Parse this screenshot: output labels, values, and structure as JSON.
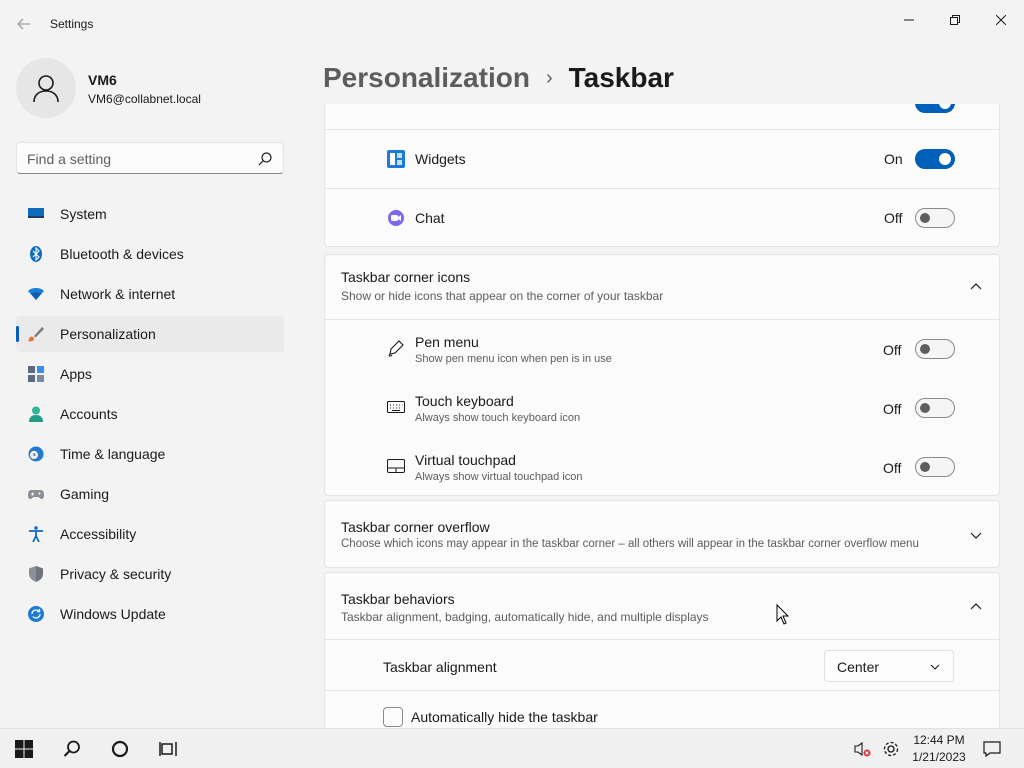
{
  "window": {
    "title": "Settings"
  },
  "profile": {
    "name": "VM6",
    "email": "VM6@collabnet.local"
  },
  "search": {
    "placeholder": "Find a setting"
  },
  "nav": [
    {
      "label": "System",
      "icon": "monitor-icon"
    },
    {
      "label": "Bluetooth & devices",
      "icon": "bluetooth-icon"
    },
    {
      "label": "Network & internet",
      "icon": "wifi-icon"
    },
    {
      "label": "Personalization",
      "icon": "brush-icon",
      "active": true
    },
    {
      "label": "Apps",
      "icon": "apps-icon"
    },
    {
      "label": "Accounts",
      "icon": "person-icon"
    },
    {
      "label": "Time & language",
      "icon": "globe-clock-icon"
    },
    {
      "label": "Gaming",
      "icon": "gamepad-icon"
    },
    {
      "label": "Accessibility",
      "icon": "accessibility-icon"
    },
    {
      "label": "Privacy & security",
      "icon": "shield-icon"
    },
    {
      "label": "Windows Update",
      "icon": "update-icon"
    }
  ],
  "header": {
    "parent": "Personalization",
    "separator": "›",
    "current": "Taskbar"
  },
  "taskbar_items": {
    "widgets": {
      "label": "Widgets",
      "state": "On",
      "on": true
    },
    "chat": {
      "label": "Chat",
      "state": "Off",
      "on": false
    }
  },
  "corner_icons": {
    "title": "Taskbar corner icons",
    "subtitle": "Show or hide icons that appear on the corner of your taskbar",
    "items": [
      {
        "title": "Pen menu",
        "subtitle": "Show pen menu icon when pen is in use",
        "state": "Off"
      },
      {
        "title": "Touch keyboard",
        "subtitle": "Always show touch keyboard icon",
        "state": "Off"
      },
      {
        "title": "Virtual touchpad",
        "subtitle": "Always show virtual touchpad icon",
        "state": "Off"
      }
    ]
  },
  "corner_overflow": {
    "title": "Taskbar corner overflow",
    "subtitle": "Choose which icons may appear in the taskbar corner – all others will appear in the taskbar corner overflow menu"
  },
  "behaviors": {
    "title": "Taskbar behaviors",
    "subtitle": "Taskbar alignment, badging, automatically hide, and multiple displays",
    "alignment_label": "Taskbar alignment",
    "alignment_value": "Center",
    "autohide_label": "Automatically hide the taskbar"
  },
  "system_taskbar": {
    "time": "12:44 PM",
    "date": "1/21/2023"
  },
  "colors": {
    "accent": "#005fb8",
    "background": "#f3f3f3",
    "card": "#fbfbfb"
  }
}
